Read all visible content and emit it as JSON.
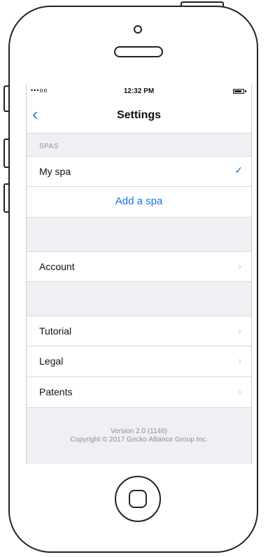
{
  "status_bar": {
    "signal": "•••oo",
    "time": "12:32 PM"
  },
  "nav": {
    "back_glyph": "‹",
    "title": "Settings"
  },
  "spas_section": {
    "header": "SPAS",
    "items": [
      {
        "label": "My spa",
        "selected": true
      }
    ],
    "add_label": "Add a spa"
  },
  "account_section": {
    "items": [
      {
        "label": "Account"
      }
    ]
  },
  "info_section": {
    "items": [
      {
        "label": "Tutorial"
      },
      {
        "label": "Legal"
      },
      {
        "label": "Patents"
      }
    ]
  },
  "footer": {
    "version": "Version 2.0 (1146)",
    "copyright": "Copyright © 2017 Gecko Alliance Group Inc."
  },
  "glyphs": {
    "chevron": "›",
    "check": "✓"
  },
  "colors": {
    "accent": "#1a73e8",
    "background": "#efeff4"
  }
}
